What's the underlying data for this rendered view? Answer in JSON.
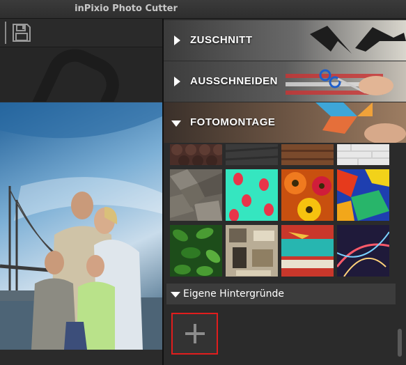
{
  "window": {
    "title": "inPixio Photo Cutter"
  },
  "toolbar": {
    "save_icon": "save-icon"
  },
  "panel": {
    "sections": [
      {
        "label": "ZUSCHNITT",
        "expanded": false
      },
      {
        "label": "AUSSCHNEIDEN",
        "expanded": false
      },
      {
        "label": "FOTOMONTAGE",
        "expanded": true
      }
    ],
    "subsection_label": "Eigene Hintergründe",
    "add_icon": "plus-icon"
  },
  "colors": {
    "accent_border": "#e11d1d",
    "panel_bg": "#2b2b2b"
  }
}
